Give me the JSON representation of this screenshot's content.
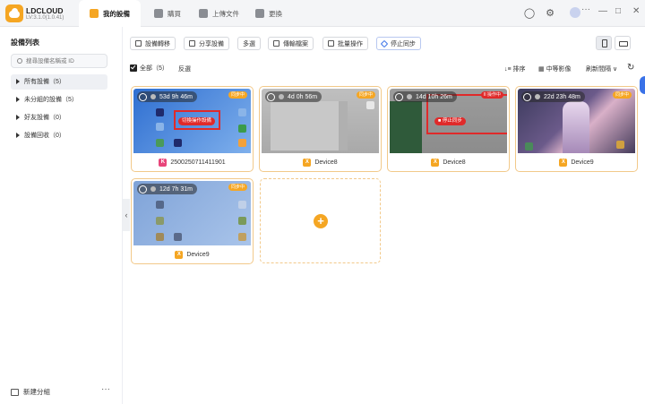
{
  "app": {
    "name": "LDCLOUD",
    "version": "LV:3.1.0(1.0.41)"
  },
  "tabs": [
    {
      "label": "我的設備"
    },
    {
      "label": "購買"
    },
    {
      "label": "上傳文件"
    },
    {
      "label": "更換"
    }
  ],
  "sidebar": {
    "title": "設備列表",
    "search_placeholder": "搜尋設備名稱或 ID",
    "items": [
      {
        "label": "所有設備（5）"
      },
      {
        "label": "未分組的設備（5）"
      },
      {
        "label": "好友設備（0）"
      },
      {
        "label": "設備回收（0）"
      }
    ],
    "new_group": "新建分組",
    "more": "···"
  },
  "toolbar": {
    "transfer": "設備轉移",
    "share": "分享設備",
    "multi": "多選",
    "batch_screenshot": "傳輸檔案",
    "batch_ops": "批量操作",
    "stop_sync": "停止同步"
  },
  "list_controls": {
    "select_all": "全部（5）",
    "invert": "反選",
    "sort": "↓≡ 排序",
    "image_size": "中等影像",
    "refresh_interval": "刷新間隔 ∨"
  },
  "devices": [
    {
      "name": "2500250711411901",
      "time": "53d 9h 46m",
      "status": "同步中",
      "overlay_button": "切換操作設備",
      "icon": "K"
    },
    {
      "name": "Device8",
      "time": "4d 0h 56m",
      "status": "同步中",
      "icon": "X"
    },
    {
      "name": "Device8",
      "time": "14d 10h 26m",
      "status": "II 操作中",
      "overlay_button": "■ 停止同步",
      "icon": "X"
    },
    {
      "name": "Device9",
      "time": "22d 23h 48m",
      "status": "同步中",
      "icon": "X"
    },
    {
      "name": "Device9",
      "time": "12d 7h 31m",
      "status": "同步中",
      "icon": "X"
    }
  ],
  "add_card": {
    "symbol": "+"
  },
  "colors": {
    "accent": "#f5a623",
    "alert_red": "#e02a2a",
    "sync_blue": "#3a72e8"
  }
}
